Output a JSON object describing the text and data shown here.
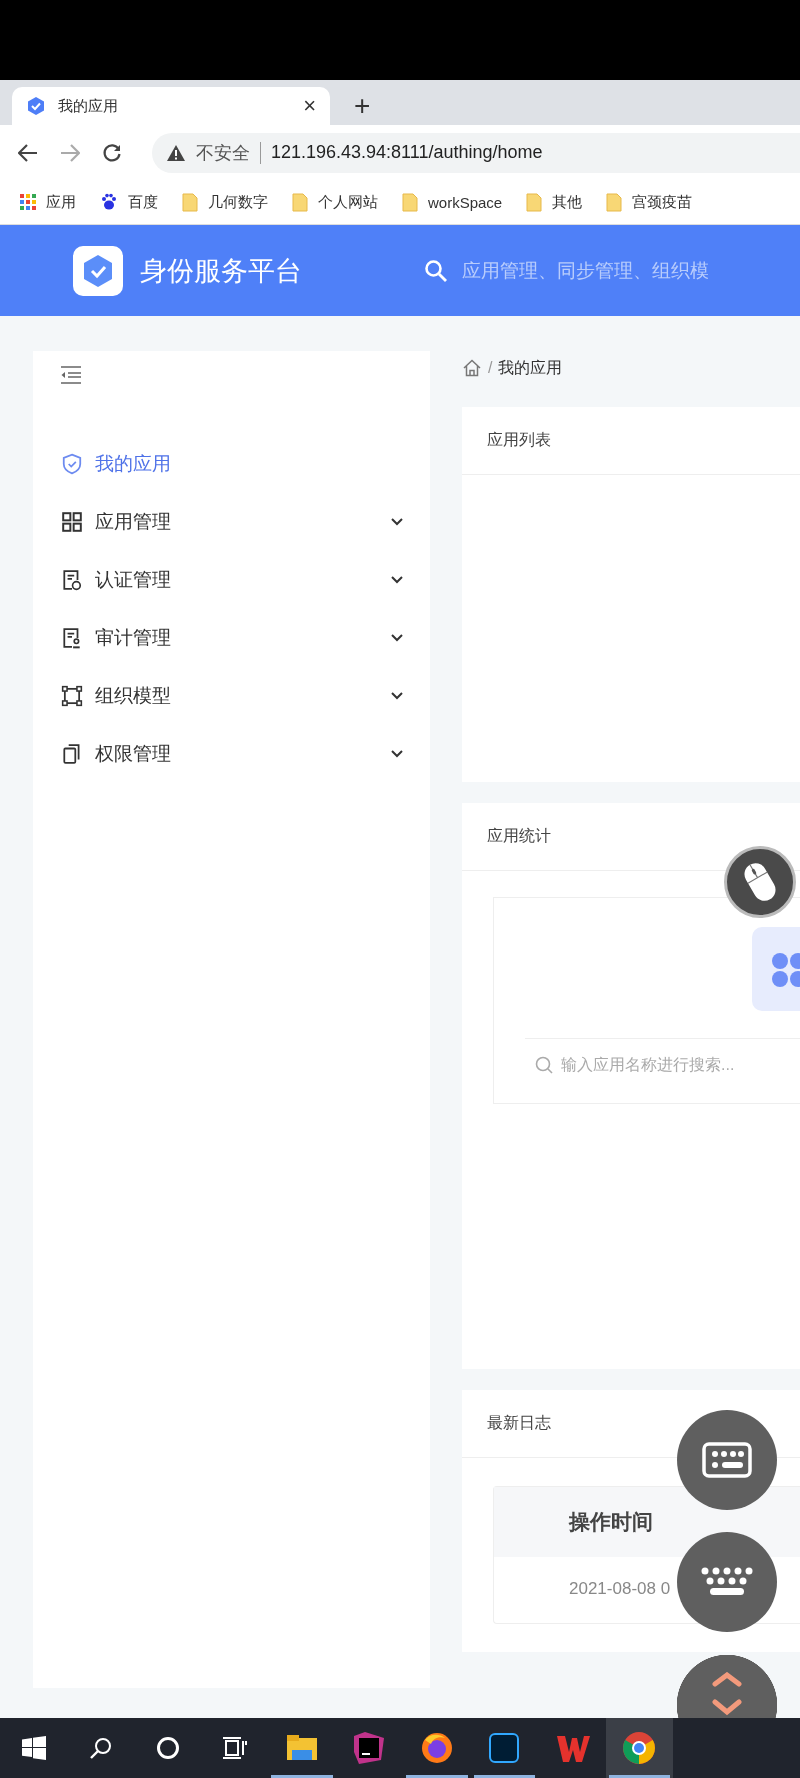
{
  "browser": {
    "tab": {
      "title": "我的应用",
      "close": "×",
      "new_tab": "+",
      "selected": true
    },
    "address": {
      "security": "不安全",
      "url": "121.196.43.94:8111/authing/home"
    },
    "bookmarks": [
      {
        "kind": "apps",
        "label": "应用"
      },
      {
        "kind": "baidu",
        "label": "百度"
      },
      {
        "kind": "folder",
        "label": "几何数字"
      },
      {
        "kind": "folder",
        "label": "个人网站"
      },
      {
        "kind": "folder",
        "label": "workSpace"
      },
      {
        "kind": "folder",
        "label": "其他"
      },
      {
        "kind": "folder",
        "label": "宫颈疫苗"
      }
    ]
  },
  "header": {
    "title": "身份服务平台",
    "search": {
      "placeholder": "应用管理、同步管理、组织模"
    }
  },
  "sidebar": {
    "items": [
      {
        "label": "我的应用",
        "selected": true,
        "kind": "link"
      },
      {
        "label": "应用管理",
        "selected": false,
        "kind": "submenu",
        "expanded": false
      },
      {
        "label": "认证管理",
        "selected": false,
        "kind": "submenu",
        "expanded": false
      },
      {
        "label": "审计管理",
        "selected": false,
        "kind": "submenu",
        "expanded": false
      },
      {
        "label": "组织模型",
        "selected": false,
        "kind": "submenu",
        "expanded": false
      },
      {
        "label": "权限管理",
        "selected": false,
        "kind": "submenu",
        "expanded": false
      }
    ]
  },
  "breadcrumb": {
    "separator": "/",
    "current": "我的应用"
  },
  "cards": [
    {
      "kind": "list",
      "title": "应用列表"
    },
    {
      "kind": "stats",
      "title": "应用统计",
      "search": {
        "placeholder": "输入应用名称进行搜索..."
      }
    },
    {
      "kind": "log",
      "title": "最新日志",
      "table": {
        "columns": [
          "操作时间"
        ],
        "rows": [
          [
            "2021-08-08 0"
          ]
        ]
      }
    }
  ],
  "taskbar": {
    "apps": [
      {
        "running": true,
        "selected": false
      },
      {
        "running": false,
        "selected": false
      },
      {
        "running": true,
        "selected": false
      },
      {
        "running": true,
        "selected": false
      },
      {
        "running": false,
        "selected": false
      },
      {
        "running": true,
        "selected": true
      }
    ]
  }
}
